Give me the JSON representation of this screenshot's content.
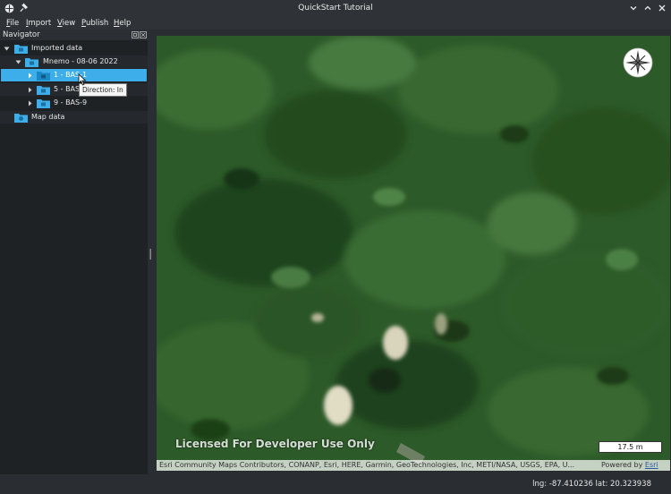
{
  "window": {
    "title": "QuickStart Tutorial",
    "icons": [
      "app-icon",
      "pin-icon",
      "chevron-down-icon",
      "chevron-up-icon",
      "close-icon"
    ]
  },
  "menu": {
    "items": [
      {
        "label": "File",
        "mnemonic": "F",
        "rest": "ile"
      },
      {
        "label": "Import",
        "mnemonic": "I",
        "rest": "mport"
      },
      {
        "label": "View",
        "mnemonic": "V",
        "rest": "iew"
      },
      {
        "label": "Publish",
        "mnemonic": "P",
        "rest": "ublish"
      },
      {
        "label": "Help",
        "mnemonic": "H",
        "rest": "elp"
      }
    ]
  },
  "navigator": {
    "title": "Navigator",
    "tree": [
      {
        "label": "Imported data",
        "expanded": true
      },
      {
        "label": "Mnemo - 08-06 2022",
        "expanded": true
      },
      {
        "label": "1 - BAS-1",
        "selected": true,
        "expanded": false
      },
      {
        "label": "5 - BAS-5",
        "expanded": false
      },
      {
        "label": "9 - BAS-9",
        "expanded": false
      },
      {
        "label": "Map data"
      }
    ],
    "tooltip": "Direction: In"
  },
  "map": {
    "license_text": "Licensed For Developer Use Only",
    "scale_label": "17.5 m",
    "attribution": "Esri Community Maps Contributors, CONANP, Esri, HERE, Garmin, GeoTechnologies, Inc, METI/NASA, USGS, EPA, U...",
    "powered_by_prefix": "Powered by ",
    "powered_by_link": "Esri",
    "icons": [
      "compass-icon"
    ]
  },
  "status": {
    "coordinates": "lng: -87.410236 lat: 20.323938"
  },
  "colors": {
    "selection": "#3daee9",
    "panel_bg": "#1f2225",
    "titlebar_bg": "#2f3337"
  }
}
